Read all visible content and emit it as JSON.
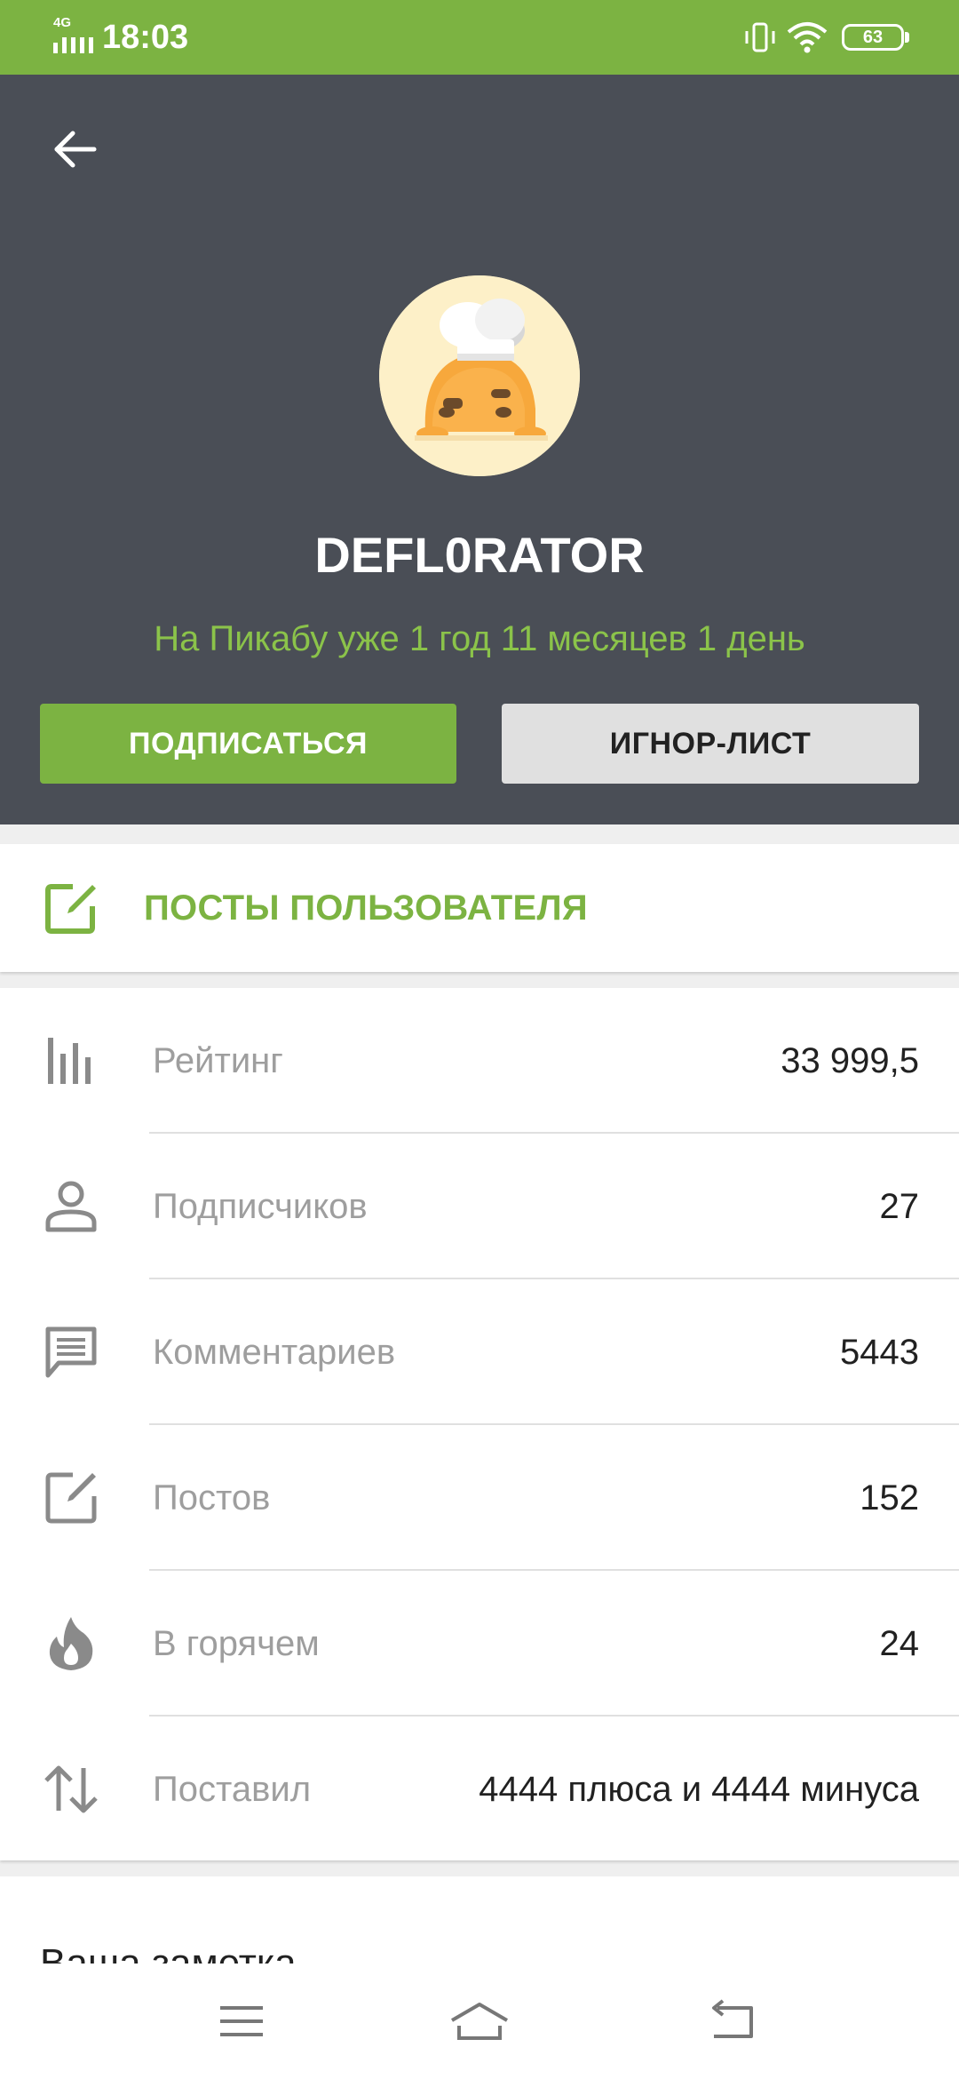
{
  "status_bar": {
    "network_type": "4G",
    "time": "18:03",
    "battery_level": "63",
    "icons": [
      "signal-icon",
      "vibrate-icon",
      "wifi-icon",
      "battery-icon"
    ]
  },
  "header": {
    "back_icon": "arrow-left-icon",
    "avatar_icon": "chef-bun-avatar",
    "username": "DEFL0RATOR",
    "member_since": "На Пикабу уже 1 год 11 месяцев 1 день",
    "subscribe_label": "ПОДПИСАТЬСЯ",
    "ignore_label": "ИГНОР-ЛИСТ"
  },
  "posts_link": {
    "icon": "edit-square-icon",
    "label": "ПОСТЫ ПОЛЬЗОВАТЕЛЯ"
  },
  "stats": [
    {
      "icon": "bar-chart-icon",
      "label": "Рейтинг",
      "value": "33 999,5"
    },
    {
      "icon": "person-icon",
      "label": "Подписчиков",
      "value": "27"
    },
    {
      "icon": "comment-icon",
      "label": "Комментариев",
      "value": "5443"
    },
    {
      "icon": "edit-square-icon",
      "label": "Постов",
      "value": "152"
    },
    {
      "icon": "flame-icon",
      "label": "В горячем",
      "value": "24"
    },
    {
      "icon": "up-down-arrows-icon",
      "label": "Поставил",
      "value": "4444 плюса и 4444 минуса"
    }
  ],
  "note": {
    "title": "Ваша заметка"
  },
  "colors": {
    "accent": "#7cb342",
    "accent_text": "#8bc34a",
    "header_bg": "#4a4e56",
    "page_bg": "#efefef"
  }
}
